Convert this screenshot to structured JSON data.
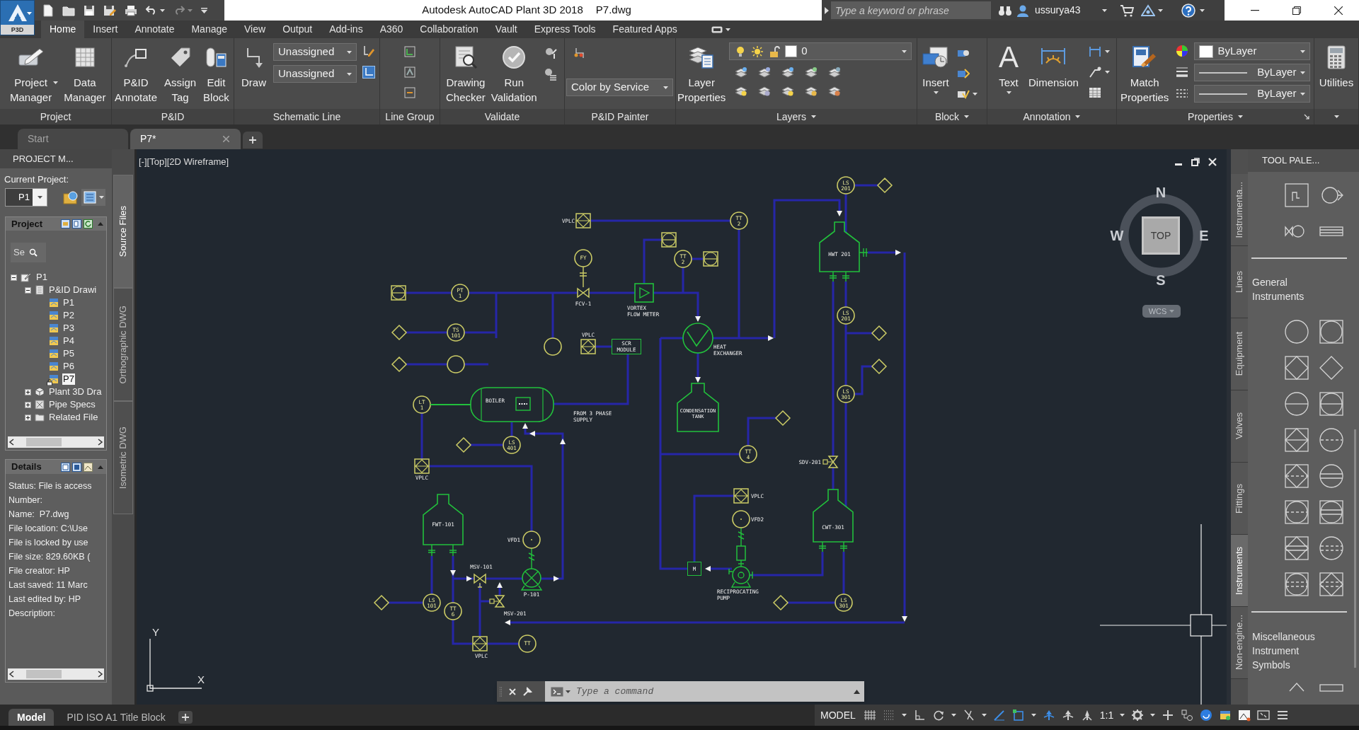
{
  "title_bar": {
    "app_badge": "P3D",
    "title": "Autodesk AutoCAD Plant 3D 2018",
    "file": "P7.dwg",
    "search": {
      "placeholder": "Type a keyword or phrase"
    },
    "user": "ussurya43"
  },
  "ribbon": {
    "tabs": [
      {
        "label": "Home",
        "selected": true
      },
      {
        "label": "Insert",
        "selected": false
      },
      {
        "label": "Annotate",
        "selected": false
      },
      {
        "label": "Manage",
        "selected": false
      },
      {
        "label": "View",
        "selected": false
      },
      {
        "label": "Output",
        "selected": false
      },
      {
        "label": "Add-ins",
        "selected": false
      },
      {
        "label": "A360",
        "selected": false
      },
      {
        "label": "Collaboration",
        "selected": false
      },
      {
        "label": "Vault",
        "selected": false
      },
      {
        "label": "Express Tools",
        "selected": false
      },
      {
        "label": "Featured Apps",
        "selected": false
      }
    ],
    "panels": [
      {
        "title": "Project",
        "menu": false,
        "items": [
          {
            "kind": "large",
            "label": "Project Manager",
            "menu": true
          },
          {
            "kind": "large",
            "label": "Data Manager",
            "menu": false
          }
        ]
      },
      {
        "title": "P&ID",
        "menu": false,
        "items": [
          {
            "kind": "large",
            "label": "P&ID Annotate",
            "menu": false
          },
          {
            "kind": "large",
            "label": "Assign Tag",
            "menu": false
          },
          {
            "kind": "large",
            "label": "Edit Block",
            "menu": false
          }
        ]
      },
      {
        "title": "Schematic Line",
        "menu": false,
        "items": [
          {
            "kind": "large",
            "label": "Draw",
            "menu": false
          },
          {
            "kind": "dropdown",
            "value": "Unassigned"
          },
          {
            "kind": "dropdown",
            "value": "Unassigned"
          }
        ]
      },
      {
        "title": "Line Group",
        "menu": false
      },
      {
        "title": "Validate",
        "menu": false,
        "items": [
          {
            "kind": "large",
            "label": "Drawing Checker",
            "menu": false
          },
          {
            "kind": "large",
            "label": "Run Validation",
            "menu": false
          }
        ]
      },
      {
        "title": "P&ID Painter",
        "menu": false,
        "items": [
          {
            "kind": "dropdown",
            "value": "Color by Service"
          }
        ]
      },
      {
        "title": "Layers",
        "menu": true,
        "items": [
          {
            "kind": "large",
            "label": "Layer Properties",
            "menu": false
          },
          {
            "kind": "layer-dropdown",
            "value": "0"
          }
        ]
      },
      {
        "title": "Block",
        "menu": true,
        "items": [
          {
            "kind": "large",
            "label": "Insert",
            "menu": true
          }
        ]
      },
      {
        "title": "Annotation",
        "menu": true,
        "items": [
          {
            "kind": "large",
            "label": "Text",
            "icon": "A",
            "menu": true
          },
          {
            "kind": "large",
            "label": "Dimension",
            "menu": false
          }
        ]
      },
      {
        "title": "Properties",
        "menu": true,
        "items": [
          {
            "kind": "large",
            "label": "Match Properties",
            "menu": false
          },
          {
            "kind": "color-dropdown",
            "value": "ByLayer"
          },
          {
            "kind": "linetype-dropdown",
            "value": "ByLayer"
          },
          {
            "kind": "linetype-dropdown",
            "value": "ByLayer"
          }
        ]
      },
      {
        "menu": true,
        "items": [
          {
            "kind": "large",
            "label": "Utilities",
            "menu": false
          }
        ]
      }
    ]
  },
  "document_tabs": [
    {
      "label": "Start",
      "selected": false
    },
    {
      "label": "P7*",
      "selected": true
    }
  ],
  "project_manager": {
    "title": "PROJECT M...",
    "current_project_label": "Current Project:",
    "current_project": "P1",
    "project_panel": {
      "title": "Project",
      "search": {
        "placeholder": "Se"
      },
      "tree": [
        {
          "label": "P1",
          "expanded": true,
          "children": [
            {
              "label": "P&ID Drawi",
              "expanded": true,
              "children": [
                {
                  "label": "P1",
                  "selected": false,
                  "locked": false
                },
                {
                  "label": "P2",
                  "selected": false,
                  "locked": false
                },
                {
                  "label": "P3",
                  "selected": false,
                  "locked": false
                },
                {
                  "label": "P4",
                  "selected": false,
                  "locked": false
                },
                {
                  "label": "P5",
                  "selected": false,
                  "locked": false
                },
                {
                  "label": "P6",
                  "selected": false,
                  "locked": false
                },
                {
                  "label": "P7",
                  "selected": true,
                  "locked": true
                }
              ]
            },
            {
              "label": "Plant 3D Dra",
              "expanded": false
            },
            {
              "label": "Pipe Specs",
              "expanded": false
            },
            {
              "label": "Related File",
              "expanded": false
            }
          ]
        }
      ]
    },
    "details": {
      "title": "Details",
      "lines": [
        "Status: File is access",
        "Number:",
        "Name:  P7.dwg",
        "File location: C:\\Use",
        "File is locked by use",
        "File size: 829.60KB (",
        "File creator: HP",
        "Last saved: 11 Marc",
        "Last edited by: HP",
        "Description:"
      ]
    },
    "side_tabs": [
      {
        "label": "Source Files",
        "selected": true
      },
      {
        "label": "Orthographic DWG",
        "selected": false
      },
      {
        "label": "Isometric DWG",
        "selected": false
      }
    ]
  },
  "viewport": {
    "view_controls": [
      "[-]",
      "[Top]",
      "[2D Wireframe]"
    ],
    "viewcube": {
      "north": "N",
      "south": "S",
      "east": "E",
      "west": "W",
      "face": "TOP",
      "coordinate_system": "WCS"
    },
    "ucs": {
      "x": "X",
      "y": "Y"
    },
    "diagram": {
      "labels": [
        "VPLC",
        "FCV-1",
        "VORTEX FLOW METER",
        "VPLC",
        "SCR MODULE",
        "HEAT EXCHANGER",
        "BOILER",
        "FROM 3 PHASE SUPPLY",
        "CONDENSATION TANK",
        "VPLC",
        "FWT-101",
        "VFD1",
        "MSV-101",
        "P-101",
        "MSV-201",
        "VPLC",
        "VPLC",
        "VFD2",
        "RECIPROCATING PUMP",
        "HWT 201",
        "SDV-201",
        "CWT-301",
        "M"
      ],
      "instrument_tags": [
        "TT 2",
        "FY",
        "PT 1",
        "TT 2",
        "TS 101",
        "LT 1",
        "LS 401",
        "TT 4",
        "LS 101",
        "TT 6",
        "TT",
        "LS 201",
        "LS 201",
        "LS 301",
        "LS 301"
      ]
    }
  },
  "command_line": {
    "placeholder": "Type a command"
  },
  "tool_palette": {
    "title": "TOOL PALE...",
    "tabs": [
      {
        "label": "Instrumenta...",
        "selected": false
      },
      {
        "label": "Lines",
        "selected": false
      },
      {
        "label": "Equipment",
        "selected": false
      },
      {
        "label": "Valves",
        "selected": false
      },
      {
        "label": "Fittings",
        "selected": false
      },
      {
        "label": "Instruments",
        "selected": true
      },
      {
        "label": "Non-engine...",
        "selected": false
      }
    ],
    "sections": [
      {
        "title": "General Instruments"
      },
      {
        "title": "Miscellaneous Instrument Symbols"
      }
    ]
  },
  "layout_tabs": [
    {
      "label": "Model",
      "selected": true
    },
    {
      "label": "PID ISO A1 Title Block",
      "selected": false
    }
  ],
  "status_bar": {
    "space": "MODEL",
    "scale": "1:1"
  }
}
